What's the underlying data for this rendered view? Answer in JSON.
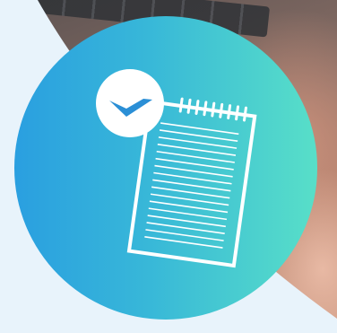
{
  "graphic": {
    "icon": "notepad-with-checkmark",
    "colors": {
      "page_background": "#e8f3fb",
      "gradient_start": "#2a9fe0",
      "gradient_end": "#58dfc8",
      "icon_stroke": "#ffffff",
      "check_color": "#2b8fd6"
    }
  }
}
